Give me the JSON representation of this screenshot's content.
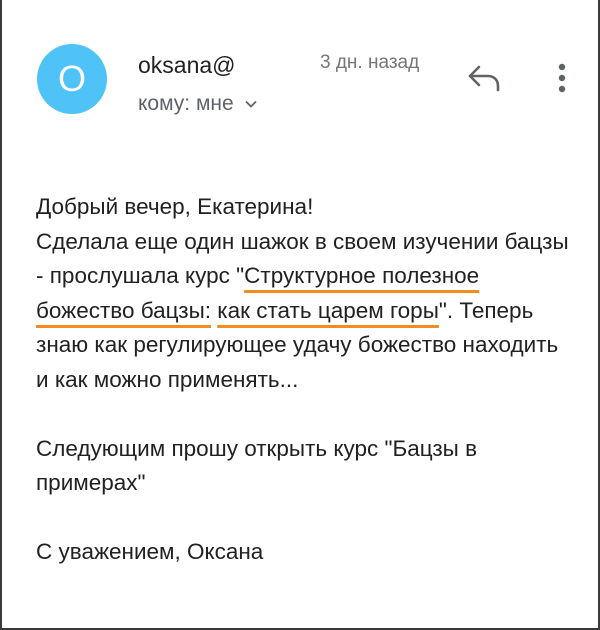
{
  "sender": {
    "avatar_letter": "O",
    "avatar_color": "#4fc3f7",
    "name": "oksana@",
    "date": "3 дн. назад",
    "recipient": "кому: мне"
  },
  "actions": {
    "reply_icon": "reply-icon",
    "more_icon": "more-vert-icon"
  },
  "message": {
    "greeting": "Добрый вечер, Екатерина!",
    "p1_before": "Сделала еще один шажок в своем изучении бацзы - прослушала курс \"",
    "p1_highlight_1": "Структурное полезное божество бацзы:",
    "p1_space": " ",
    "p1_highlight_2": "как стать царем горы",
    "p1_after": "\". Теперь знаю как регулирующее удачу божество находить и как можно применять...",
    "p2": "Следующим прошу открыть курс \"Бацзы в примерах\"",
    "signature": "С уважением, Оксана"
  },
  "highlight_color": "#f28c1e"
}
